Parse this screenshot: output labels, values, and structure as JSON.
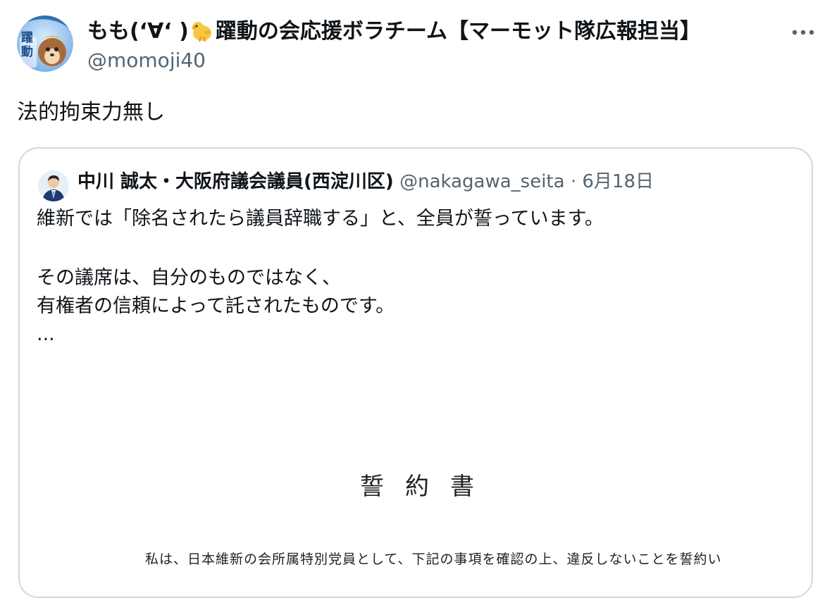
{
  "author": {
    "display_name_part1": "もも(ʻ∀ʻ )",
    "display_name_part2": "躍動の会応援ボラチーム【マーモット隊広報担当】",
    "handle": "@momoji40",
    "avatar_text": "躍動"
  },
  "tweet": {
    "text": "法的拘束力無し"
  },
  "quoted": {
    "name": "中川 誠太・大阪府議会議員(西淀川区)",
    "handle": "@nakagawa_seita",
    "separator": "·",
    "date": "6月18日",
    "lines": [
      "維新では「除名されたら議員辞職する」と、全員が誓っています。",
      "その議席は、自分のものではなく、",
      "有権者の信頼によって託されたものです。",
      "..."
    ],
    "document": {
      "title": "誓約書",
      "body": "私は、日本維新の会所属特別党員として、下記の事項を確認の上、違反しないことを誓約い"
    }
  },
  "colors": {
    "text": "#0f1419",
    "secondary": "#536471",
    "border": "#cfd9de"
  },
  "icons": {
    "more": "more-horizontal-icon",
    "chick": "baby-chick-emoji"
  }
}
